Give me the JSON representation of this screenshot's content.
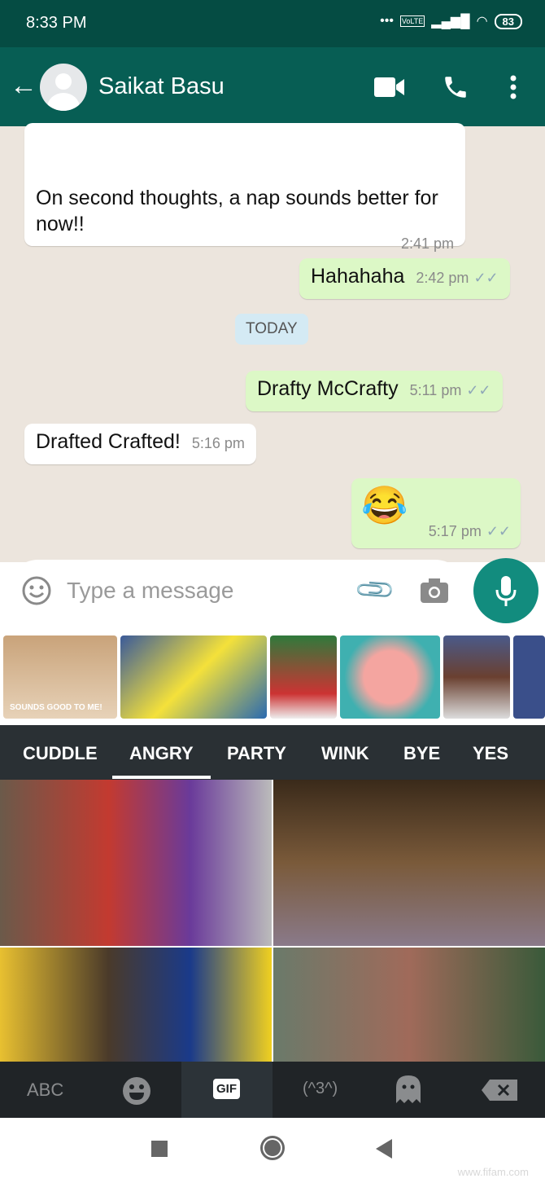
{
  "status_bar": {
    "time": "8:33 PM",
    "network": "VoLTE",
    "battery": "83"
  },
  "header": {
    "contact_name": "Saikat Basu"
  },
  "messages": [
    {
      "direction": "in",
      "text": "On second thoughts, a nap sounds better for now!!",
      "time": "2:41 pm"
    },
    {
      "direction": "out",
      "text": "Hahahaha",
      "time": "2:42 pm",
      "status": "read"
    },
    {
      "type": "date",
      "text": "TODAY"
    },
    {
      "direction": "out",
      "text": "Drafty McCrafty",
      "time": "5:11 pm",
      "status": "read"
    },
    {
      "direction": "in",
      "text": "Drafted Crafted!",
      "time": "5:16 pm"
    },
    {
      "direction": "out",
      "text": "😂",
      "time": "5:17 pm",
      "status": "read"
    }
  ],
  "input": {
    "placeholder": "Type a message"
  },
  "sticker_strip": {
    "first_caption": "SOUNDS GOOD TO ME!"
  },
  "gif_tabs": [
    {
      "label": "CUDDLE"
    },
    {
      "label": "ANGRY",
      "active": true
    },
    {
      "label": "PARTY"
    },
    {
      "label": "WINK"
    },
    {
      "label": "BYE"
    },
    {
      "label": "YES"
    }
  ],
  "keyboard_bar": {
    "abc": "ABC",
    "gif": "GIF",
    "kaomoji": "(^3^)",
    "active": "GIF"
  },
  "watermark": "www.fifam.com",
  "colors": {
    "header": "#075e54",
    "status": "#054c43",
    "outgoing": "#dcf8c6",
    "accent": "#128c7e"
  }
}
